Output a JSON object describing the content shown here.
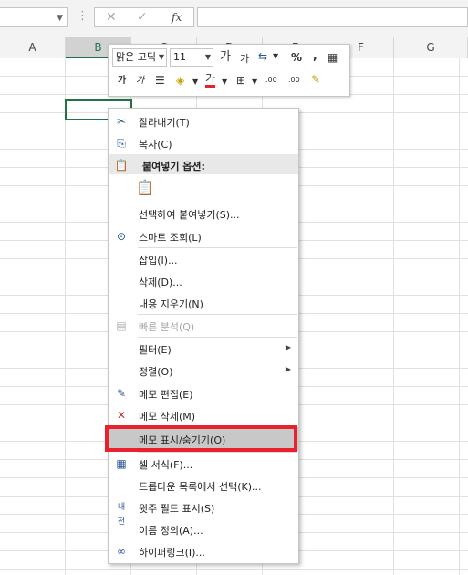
{
  "formula_bar": {
    "fx_label": "fx",
    "cancel_glyph": "✕",
    "enter_glyph": "✓"
  },
  "columns": [
    "A",
    "B",
    "C",
    "D",
    "E",
    "F",
    "G"
  ],
  "mini_toolbar": {
    "font_name": "맑은 고딕",
    "font_size": "11",
    "grow_font": "가",
    "shrink_font": "가",
    "percent": "%",
    "comma": ",",
    "bold": "가",
    "italic": "가",
    "font_color_letter": "가",
    "inc_decimal": ".00",
    "dec_decimal": ".00"
  },
  "context_menu": {
    "items": [
      {
        "label": "잘라내기(T)",
        "icon": "cut-icon"
      },
      {
        "label": "복사(C)",
        "icon": "copy-icon"
      },
      {
        "label": "붙여넣기 옵션:",
        "icon": "paste-icon"
      },
      {
        "label": "선택하여 붙여넣기(S)..."
      },
      {
        "label": "스마트 조회(L)",
        "icon": "smart-lookup-icon"
      },
      {
        "label": "삽입(I)..."
      },
      {
        "label": "삭제(D)..."
      },
      {
        "label": "내용 지우기(N)"
      },
      {
        "label": "빠른 분석(Q)",
        "icon": "quick-analysis-icon"
      },
      {
        "label": "필터(E)"
      },
      {
        "label": "정렬(O)"
      },
      {
        "label": "메모 편집(E)",
        "icon": "edit-comment-icon"
      },
      {
        "label": "메모 삭제(M)",
        "icon": "delete-comment-icon"
      },
      {
        "label": "메모 표시/숨기기(O)"
      },
      {
        "label": "셀 서식(F)...",
        "icon": "format-cells-icon"
      },
      {
        "label": "드롭다운 목록에서 선택(K)..."
      },
      {
        "label": "윗주 필드 표시(S)",
        "icon": "phonetic-icon"
      },
      {
        "label": "이름 정의(A)..."
      },
      {
        "label": "하이퍼링크(I)...",
        "icon": "hyperlink-icon"
      }
    ]
  },
  "colors": {
    "accent": "#217346",
    "highlight_border": "#e8212e",
    "menu_highlight": "#c8c8c8"
  }
}
